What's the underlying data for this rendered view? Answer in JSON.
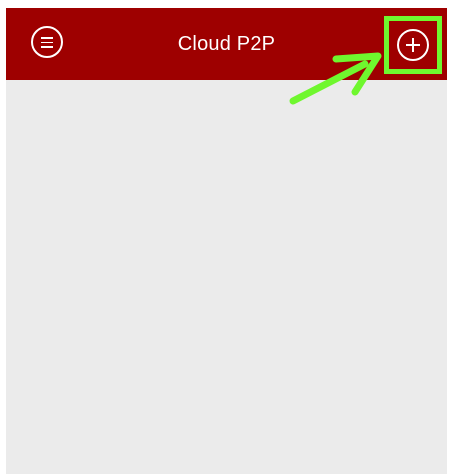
{
  "app": {
    "title": "Cloud P2P"
  },
  "header": {
    "menu_icon": "menu-icon",
    "add_icon": "add-icon"
  },
  "annotation": {
    "highlight_color": "#6ff72e",
    "arrow_color": "#6ff72e"
  },
  "colors": {
    "header_bg": "#9e0000",
    "content_bg": "#ebebeb"
  }
}
